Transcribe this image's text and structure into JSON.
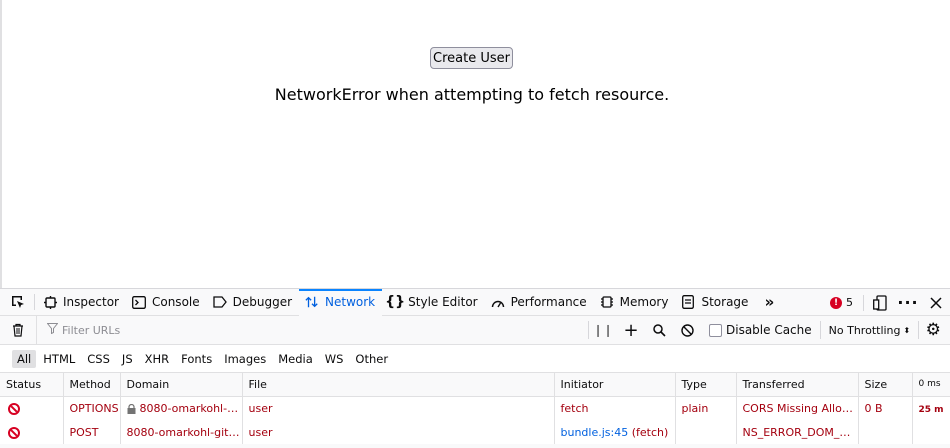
{
  "page": {
    "create_button": "Create User",
    "error_message": "NetworkError when attempting to fetch resource."
  },
  "devtools": {
    "tabs": [
      {
        "label": "Inspector"
      },
      {
        "label": "Console"
      },
      {
        "label": "Debugger"
      },
      {
        "label": "Network"
      },
      {
        "label": "Style Editor"
      },
      {
        "label": "Performance"
      },
      {
        "label": "Memory"
      },
      {
        "label": "Storage"
      }
    ],
    "selected_tab": "Network",
    "error_count": "5",
    "accent_color": "#0a84ff",
    "error_color": "#d70022"
  },
  "network": {
    "filter_placeholder": "Filter URLs",
    "disable_cache_label": "Disable Cache",
    "throttling": "No Throttling",
    "type_filters": [
      "All",
      "HTML",
      "CSS",
      "JS",
      "XHR",
      "Fonts",
      "Images",
      "Media",
      "WS",
      "Other"
    ],
    "active_filter": "All",
    "columns": [
      "Status",
      "Method",
      "Domain",
      "File",
      "Initiator",
      "Type",
      "Transferred",
      "Size",
      "0 ms"
    ],
    "rows": [
      {
        "method": "OPTIONS",
        "domain": "8080-omarkohl-g…",
        "file": "user",
        "initiator": "fetch",
        "initiator_suffix": "",
        "type": "plain",
        "transferred": "CORS Missing Allow…",
        "size": "0 B",
        "waterfall": "25 m"
      },
      {
        "method": "POST",
        "domain": "8080-omarkohl-gitp…",
        "file": "user",
        "initiator": "bundle.js:45",
        "initiator_suffix": " (fetch)",
        "type": "",
        "transferred": "NS_ERROR_DOM_B…",
        "size": "",
        "waterfall": ""
      }
    ]
  }
}
